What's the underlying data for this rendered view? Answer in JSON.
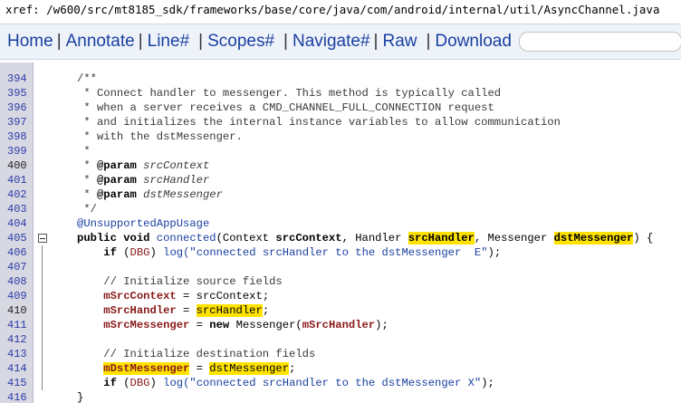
{
  "xref": {
    "label": "xref: ",
    "path": "/w600/src/mt8185_sdk/frameworks/base/core/java/com/android/internal/util/AsyncChannel.java"
  },
  "nav": {
    "home": "Home",
    "annotate": "Annotate",
    "line": "Line#",
    "scopes": "Scopes#",
    "navigate": "Navigate#",
    "raw": "Raw",
    "download": "Download",
    "sep": "|"
  },
  "search": {
    "placeholder": ""
  },
  "code": {
    "l394": {
      "n": "394",
      "t": "/**"
    },
    "l395": {
      "n": "395",
      "t": " * Connect handler to messenger. This method is typically called"
    },
    "l396": {
      "n": "396",
      "t": " * when a server receives a CMD_CHANNEL_FULL_CONNECTION request"
    },
    "l397": {
      "n": "397",
      "t": " * and initializes the internal instance variables to allow communication"
    },
    "l398": {
      "n": "398",
      "t": " * with the dstMessenger."
    },
    "l399": {
      "n": "399",
      "t": " *"
    },
    "l400": {
      "n": "400",
      "a": " * ",
      "b": "@param",
      "c": " ",
      "d": "srcContext"
    },
    "l401": {
      "n": "401",
      "a": " * ",
      "b": "@param",
      "c": " ",
      "d": "srcHandler"
    },
    "l402": {
      "n": "402",
      "a": " * ",
      "b": "@param",
      "c": " ",
      "d": "dstMessenger"
    },
    "l403": {
      "n": "403",
      "t": " */"
    },
    "l404": {
      "n": "404",
      "t": "@UnsupportedAppUsage"
    },
    "l405": {
      "n": "405",
      "p1": "public void ",
      "fn": "connected",
      "p2": "(Context ",
      "a1": "srcContext",
      "p3": ", Handler ",
      "a2": "srcHandler",
      "p4": ", Messenger ",
      "a3": "dstMessenger",
      "p5": ") {"
    },
    "l406": {
      "n": "406",
      "i": "    ",
      "k": "if",
      "p1": " (",
      "d": "DBG",
      "p2": ") ",
      "fn": "log",
      "s": "(\"connected srcHandler to the dstMessenger  E\"",
      "p3": ");"
    },
    "l407": {
      "n": "407"
    },
    "l408": {
      "n": "408",
      "t": "    // Initialize source fields"
    },
    "l409": {
      "n": "409",
      "i": "    ",
      "f": "mSrcContext",
      "p1": " = ",
      "v": "srcContext",
      "p2": ";"
    },
    "l410": {
      "n": "410",
      "i": "    ",
      "f": "mSrcHandler",
      "p1": " = ",
      "v": "srcHandler",
      "p2": ";"
    },
    "l411": {
      "n": "411",
      "i": "    ",
      "f": "mSrcMessenger",
      "p1": " = ",
      "k": "new",
      "p2": " Messenger(",
      "f2": "mSrcHandler",
      "p3": ");"
    },
    "l412": {
      "n": "412"
    },
    "l413": {
      "n": "413",
      "t": "    // Initialize destination fields"
    },
    "l414": {
      "n": "414",
      "i": "    ",
      "f": "mDstMessenger",
      "p1": " = ",
      "v": "dstMessenger",
      "p2": ";"
    },
    "l415": {
      "n": "415",
      "i": "    ",
      "k": "if",
      "p1": " (",
      "d": "DBG",
      "p2": ") ",
      "fn": "log",
      "s": "(\"connected srcHandler to the dstMessenger X\"",
      "p3": ");"
    },
    "l416": {
      "n": "416",
      "t": "}"
    }
  },
  "colors": {
    "link": "#1a3fa0",
    "highlight": "#ffe200",
    "gutter": "#d8d8e2",
    "field": "#8b1a1a"
  }
}
